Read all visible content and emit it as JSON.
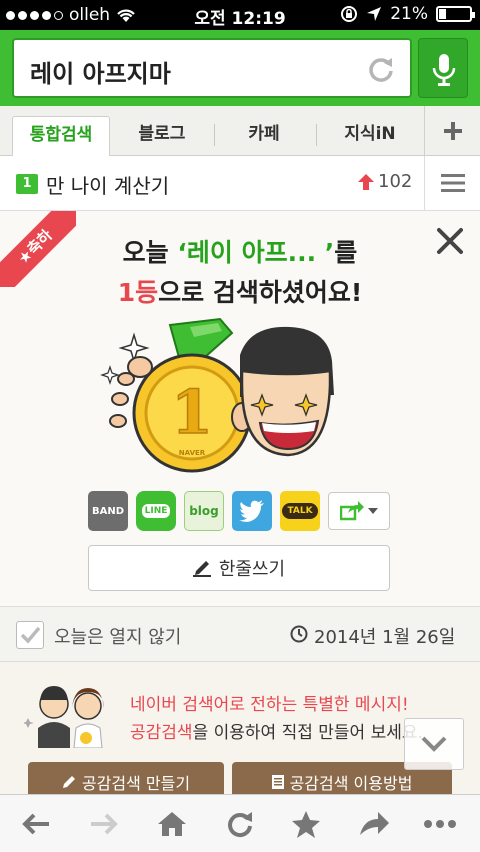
{
  "status_bar": {
    "carrier": "olleh",
    "time": "오전 12:19",
    "battery_percent": "21%",
    "battery_level": 0.21
  },
  "search": {
    "query": "레이 아프지마"
  },
  "tabs": [
    {
      "label": "통합검색",
      "active": true
    },
    {
      "label": "블로그",
      "active": false
    },
    {
      "label": "카페",
      "active": false
    },
    {
      "label": "지식iN",
      "active": false
    }
  ],
  "trending": {
    "rank": "1",
    "keyword": "만 나이 계산기",
    "count": "102"
  },
  "congrats": {
    "ribbon": "축하",
    "line1_prefix": "오늘 ",
    "line1_keyword": "‘레이 아프...  ’",
    "line1_suffix": "를",
    "line2_rank": "1등",
    "line2_suffix": "으로 검색하셨어요!",
    "badge": "NAVER",
    "share": [
      {
        "name": "band",
        "label": "BAND",
        "color": "#6d6d6d"
      },
      {
        "name": "line",
        "label": "LINE",
        "color": "#3fbe33"
      },
      {
        "name": "blog",
        "label": "blog",
        "color": "#e9f3dc"
      },
      {
        "name": "twitter",
        "label": "",
        "color": "#3fa6e0"
      },
      {
        "name": "kakaotalk",
        "label": "TALK",
        "color": "#f7d21a"
      }
    ],
    "oneline_label": "한줄쓰기"
  },
  "hide_today": {
    "label": "오늘은 열지 않기",
    "date": "2014년 1월 26일"
  },
  "promo": {
    "line1": "네이버 검색어로 전하는 특별한 메시지!",
    "line2_accent": "공감검색",
    "line2_rest": "을 이용하여 직접 만들어 보세요.",
    "button_make": "공감검색 만들기",
    "button_howto": "공감검색 이용방법"
  },
  "colors": {
    "naver_green": "#3fbe33",
    "accent_red": "#e8474f"
  }
}
